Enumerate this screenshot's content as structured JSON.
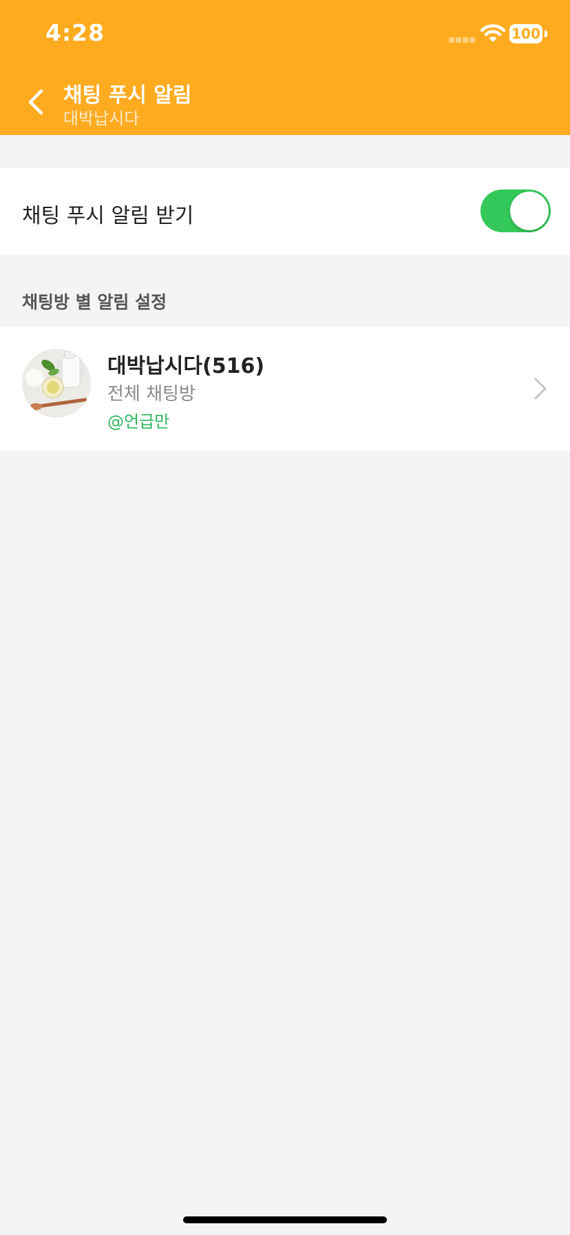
{
  "status_bar": {
    "time": "4:28",
    "battery": "100"
  },
  "nav": {
    "title": "채팅 푸시 알림",
    "subtitle": "대박납시다"
  },
  "push_setting": {
    "label": "채팅 푸시 알림 받기",
    "enabled": true
  },
  "section": {
    "title": "채팅방 별 알림 설정"
  },
  "rooms": [
    {
      "name": "대박납시다(516)",
      "type": "전체 채팅방",
      "mention": "@언급만"
    }
  ],
  "colors": {
    "header": "#ffab20",
    "toggle_on": "#34c759",
    "mention": "#2cb65e",
    "background": "#f3f4f6"
  },
  "icons": {
    "back": "chevron-left-icon",
    "row_arrow": "chevron-right-icon",
    "wifi": "wifi-icon",
    "battery": "battery-icon"
  }
}
